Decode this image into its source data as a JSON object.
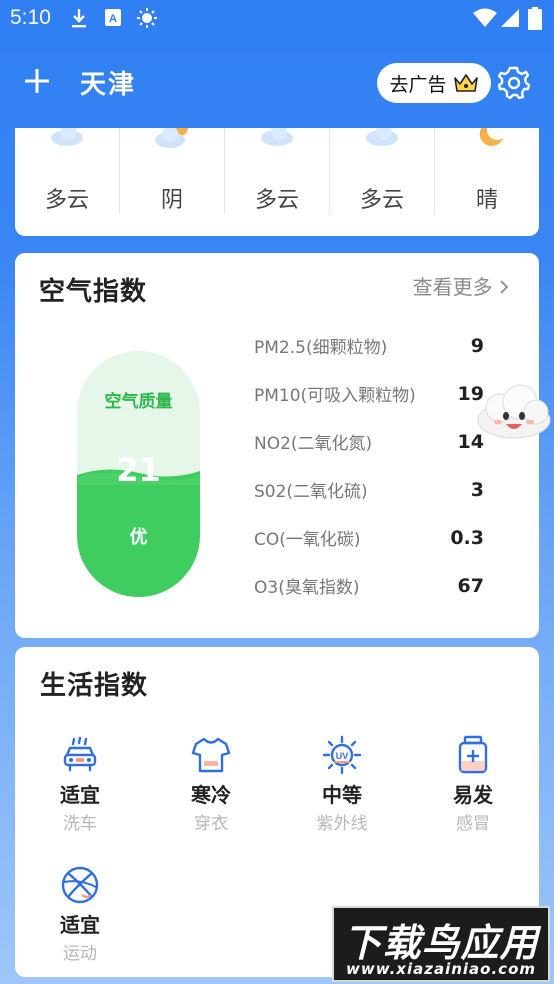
{
  "status_bar": {
    "time": "5:10"
  },
  "header": {
    "city": "天津",
    "ad_button": "去广告"
  },
  "forecast": {
    "items": [
      {
        "label": "多云",
        "icon": "cloud-icon"
      },
      {
        "label": "阴",
        "icon": "sun-cloud-icon"
      },
      {
        "label": "多云",
        "icon": "cloud-icon"
      },
      {
        "label": "多云",
        "icon": "cloud-icon"
      },
      {
        "label": "晴",
        "icon": "moon-icon"
      }
    ]
  },
  "air_quality": {
    "title": "空气指数",
    "more": "查看更多",
    "capsule": {
      "title": "空气质量",
      "value": "21",
      "grade": "优",
      "level": 0.48
    },
    "pollutants": [
      {
        "name": "PM2.5(细颗粒物)",
        "value": "9"
      },
      {
        "name": "PM10(可吸入颗粒物)",
        "value": "19"
      },
      {
        "name": "NO2(二氧化氮)",
        "value": "14"
      },
      {
        "name": "S02(二氧化硫)",
        "value": "3"
      },
      {
        "name": "CO(一氧化碳)",
        "value": "0.3"
      },
      {
        "name": "O3(臭氧指数)",
        "value": "67"
      }
    ],
    "colors": {
      "good": "#3fcd5f",
      "good_light": "#e6f7e9"
    }
  },
  "life_index": {
    "title": "生活指数",
    "items": [
      {
        "value": "适宜",
        "name": "洗车",
        "icon": "car-wash-icon"
      },
      {
        "value": "寒冷",
        "name": "穿衣",
        "icon": "tshirt-icon"
      },
      {
        "value": "中等",
        "name": "紫外线",
        "icon": "uv-sun-icon"
      },
      {
        "value": "易发",
        "name": "感冒",
        "icon": "medicine-icon"
      },
      {
        "value": "适宜",
        "name": "运动",
        "icon": "basketball-icon"
      }
    ]
  },
  "watermark": {
    "line1": "下载鸟应用",
    "line2": "www.xiazainiao.com"
  },
  "colors": {
    "accent": "#2f7ff3",
    "icon_blue": "#2f6fe0"
  }
}
